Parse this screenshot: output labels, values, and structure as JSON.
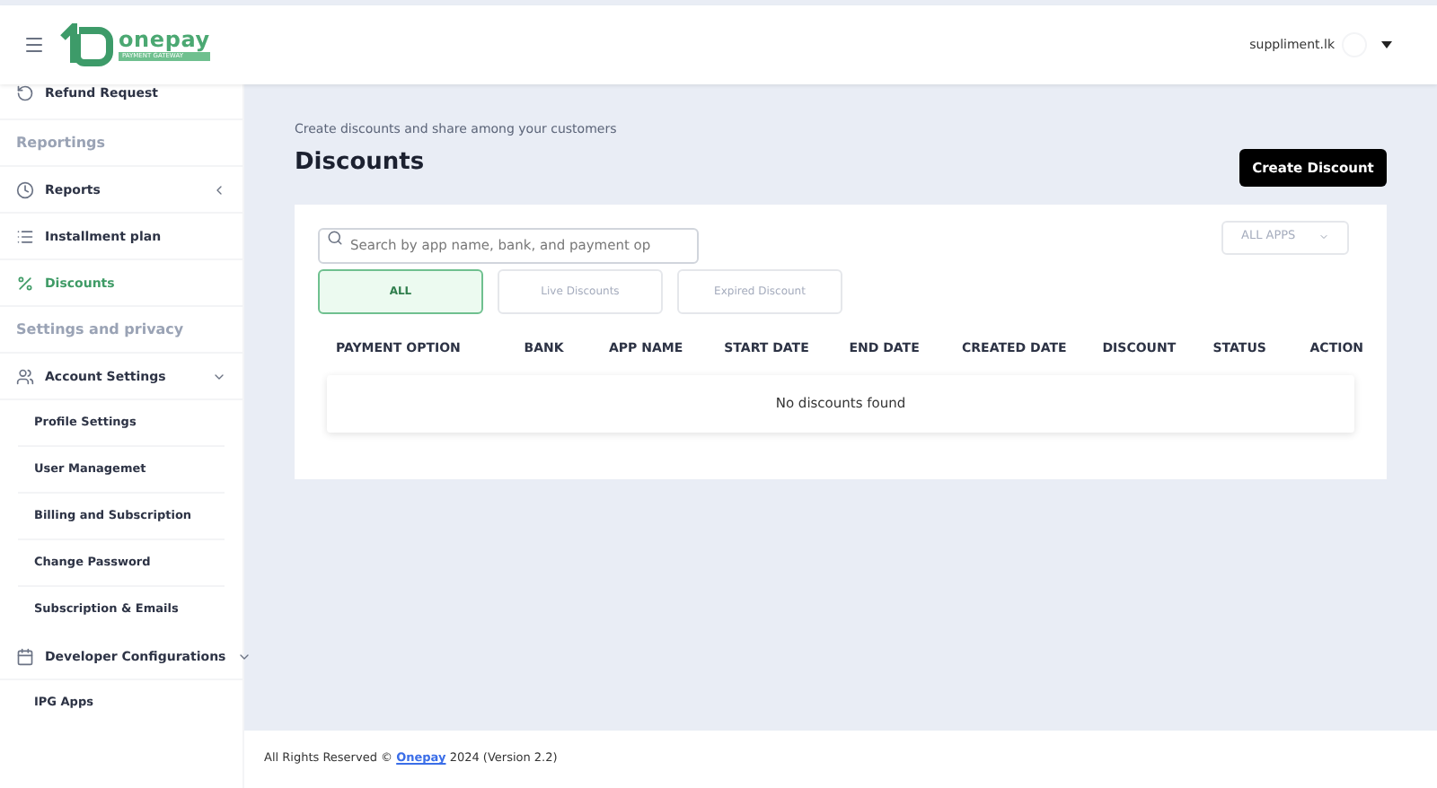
{
  "header": {
    "logo": {
      "name": "onepay",
      "tagline": "PAYMENT GATEWAY"
    },
    "user": "suppliment.lk"
  },
  "sidebar": {
    "items": [
      {
        "kind": "item",
        "label": "Refund Request",
        "selected": false
      },
      {
        "kind": "section",
        "label": "Reportings"
      },
      {
        "kind": "item",
        "label": "Reports",
        "selected": false,
        "expanded": false
      },
      {
        "kind": "item",
        "label": "Installment plan",
        "selected": false
      },
      {
        "kind": "item",
        "label": "Discounts",
        "selected": true
      },
      {
        "kind": "section",
        "label": "Settings and privacy"
      },
      {
        "kind": "item",
        "label": "Account Settings",
        "selected": false,
        "expanded": true,
        "children": [
          {
            "label": "Profile Settings"
          },
          {
            "label": "User Managemet"
          },
          {
            "label": "Billing and Subscription"
          },
          {
            "label": "Change Password"
          },
          {
            "label": "Subscription & Emails"
          }
        ]
      },
      {
        "kind": "item",
        "label": "Developer Configurations",
        "selected": false,
        "expanded": true,
        "children": [
          {
            "label": "IPG Apps"
          }
        ]
      }
    ]
  },
  "page": {
    "subtitle": "Create discounts and share among your customers",
    "title": "Discounts",
    "create_button": "Create Discount"
  },
  "search": {
    "placeholder": "Search by app name, bank, and payment op"
  },
  "app_filter": {
    "value": "ALL APPS"
  },
  "tabs": [
    {
      "label": "ALL",
      "selected": true
    },
    {
      "label": "Live Discounts",
      "selected": false
    },
    {
      "label": "Expired Discount",
      "selected": false
    }
  ],
  "table": {
    "columns": [
      "PAYMENT OPTION",
      "BANK",
      "APP NAME",
      "START DATE",
      "END DATE",
      "CREATED DATE",
      "DISCOUNT",
      "STATUS",
      "ACTION"
    ],
    "empty_message": "No discounts found"
  },
  "footer": {
    "before": "All Rights Reserved ©",
    "link": "Onepay",
    "after": "2024 (Version 2.2)"
  }
}
